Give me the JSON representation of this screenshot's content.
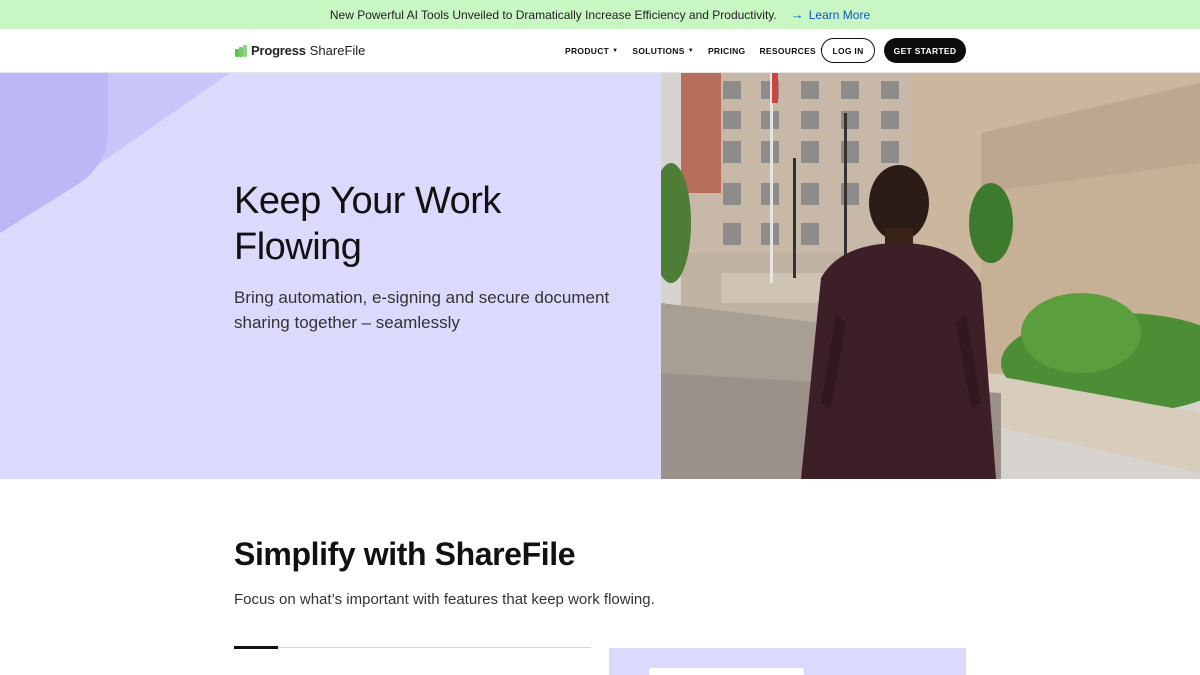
{
  "announcement": {
    "message": "New Powerful AI Tools Unveiled to Dramatically Increase Efficiency and Productivity.",
    "link_label": "Learn More"
  },
  "nav": {
    "brand": "Progress",
    "product": "ShareFile",
    "menu": [
      {
        "label": "PRODUCT",
        "has_dropdown": true
      },
      {
        "label": "SOLUTIONS",
        "has_dropdown": true
      },
      {
        "label": "PRICING",
        "has_dropdown": false
      },
      {
        "label": "RESOURCES",
        "has_dropdown": true
      }
    ],
    "login_label": "LOG IN",
    "cta_label": "GET STARTED"
  },
  "hero": {
    "title": "Keep Your Work Flowing",
    "subtitle": "Bring automation, e-signing and secure document sharing together – seamlessly"
  },
  "features": {
    "title": "Simplify with ShareFile",
    "subtitle": "Focus on what’s important with features that keep work flowing."
  },
  "colors": {
    "announcement_bg": "#c9f7c3",
    "hero_bg": "#dcdafc",
    "accent_green": "#5cc24a",
    "link_blue": "#0b57d0"
  }
}
